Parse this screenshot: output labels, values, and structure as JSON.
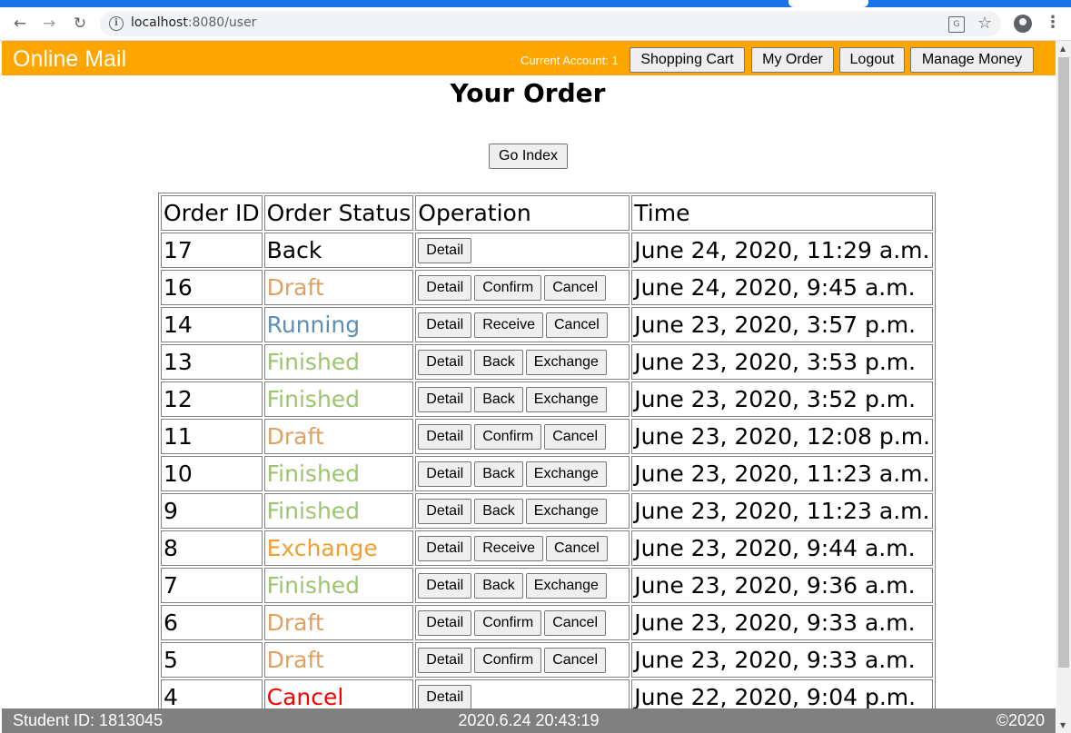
{
  "browser": {
    "url_host": "localhost",
    "url_rest": ":8080/user"
  },
  "header": {
    "brand": "Online Mail",
    "account_label": "Current Account: 1",
    "buttons": [
      "Shopping Cart",
      "My Order",
      "Logout",
      "Manage Money"
    ],
    "bg_color": "#ffa500"
  },
  "main": {
    "title": "Your Order",
    "go_index": "Go Index"
  },
  "table": {
    "headers": [
      "Order ID",
      "Order Status",
      "Operation",
      "Time"
    ],
    "rows": [
      {
        "id": "17",
        "status": "Back",
        "color": "#000000",
        "ops": [
          "Detail"
        ],
        "time": "June 24, 2020, 11:29 a.m."
      },
      {
        "id": "16",
        "status": "Draft",
        "color": "#e0a060",
        "ops": [
          "Detail",
          "Confirm",
          "Cancel"
        ],
        "time": "June 24, 2020, 9:45 a.m."
      },
      {
        "id": "14",
        "status": "Running",
        "color": "#5b8fb9",
        "ops": [
          "Detail",
          "Receive",
          "Cancel"
        ],
        "time": "June 23, 2020, 3:57 p.m."
      },
      {
        "id": "13",
        "status": "Finished",
        "color": "#9dc46e",
        "ops": [
          "Detail",
          "Back",
          "Exchange"
        ],
        "time": "June 23, 2020, 3:53 p.m."
      },
      {
        "id": "12",
        "status": "Finished",
        "color": "#9dc46e",
        "ops": [
          "Detail",
          "Back",
          "Exchange"
        ],
        "time": "June 23, 2020, 3:52 p.m."
      },
      {
        "id": "11",
        "status": "Draft",
        "color": "#e0a060",
        "ops": [
          "Detail",
          "Confirm",
          "Cancel"
        ],
        "time": "June 23, 2020, 12:08 p.m."
      },
      {
        "id": "10",
        "status": "Finished",
        "color": "#9dc46e",
        "ops": [
          "Detail",
          "Back",
          "Exchange"
        ],
        "time": "June 23, 2020, 11:23 a.m."
      },
      {
        "id": "9",
        "status": "Finished",
        "color": "#9dc46e",
        "ops": [
          "Detail",
          "Back",
          "Exchange"
        ],
        "time": "June 23, 2020, 11:23 a.m."
      },
      {
        "id": "8",
        "status": "Exchange",
        "color": "#f0a030",
        "ops": [
          "Detail",
          "Receive",
          "Cancel"
        ],
        "time": "June 23, 2020, 9:44 a.m."
      },
      {
        "id": "7",
        "status": "Finished",
        "color": "#9dc46e",
        "ops": [
          "Detail",
          "Back",
          "Exchange"
        ],
        "time": "June 23, 2020, 9:36 a.m."
      },
      {
        "id": "6",
        "status": "Draft",
        "color": "#e0a060",
        "ops": [
          "Detail",
          "Confirm",
          "Cancel"
        ],
        "time": "June 23, 2020, 9:33 a.m."
      },
      {
        "id": "5",
        "status": "Draft",
        "color": "#e0a060",
        "ops": [
          "Detail",
          "Confirm",
          "Cancel"
        ],
        "time": "June 23, 2020, 9:33 a.m."
      },
      {
        "id": "4",
        "status": "Cancel",
        "color": "#ff0000",
        "ops": [
          "Detail"
        ],
        "time": "June 22, 2020, 9:04 p.m."
      }
    ]
  },
  "footer": {
    "student_id": "Student ID: 1813045",
    "datetime": "2020.6.24 20:43:19",
    "copyright": "©2020"
  }
}
